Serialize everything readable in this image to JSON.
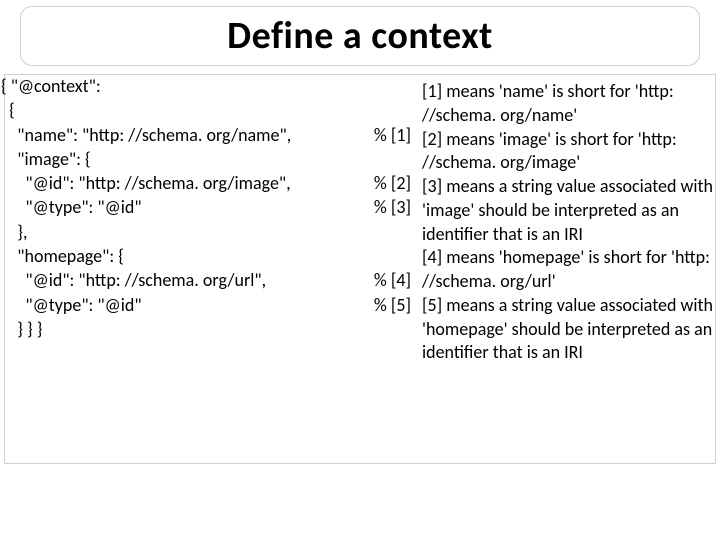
{
  "title": "Define a context",
  "code": {
    "l1": "{ \"@context\":",
    "l2": "  {",
    "l3a": "    \"name\": \"http: //schema. org/name\",",
    "l3b": "% [1]",
    "l4": "    \"image\": {",
    "l5a": "      \"@id\": \"http: //schema. org/image\",",
    "l5b": "% [2]",
    "l6a": "      \"@type\": \"@id\"",
    "l6b": "% [3]",
    "l7": "    },",
    "l8": "    \"homepage\": {",
    "l9a": "      \"@id\": \"http: //schema. org/url\",",
    "l9b": "% [4]",
    "l10a": "      \"@type\": \"@id\"",
    "l10b": "% [5]",
    "l11": "    } } }"
  },
  "explain": {
    "p1": "[1] means 'name' is short for 'http: //schema. org/name'",
    "p2": "[2] means 'image' is short for 'http: //schema. org/image'",
    "p3": "[3] means a string value associated with 'image' should be interpreted as an identifier that is an IRI",
    "p4": "[4] means 'homepage' is short for 'http: //schema. org/url'",
    "p5": "[5] means a string value associated with 'homepage' should be interpreted as an identifier that is an IRI"
  }
}
